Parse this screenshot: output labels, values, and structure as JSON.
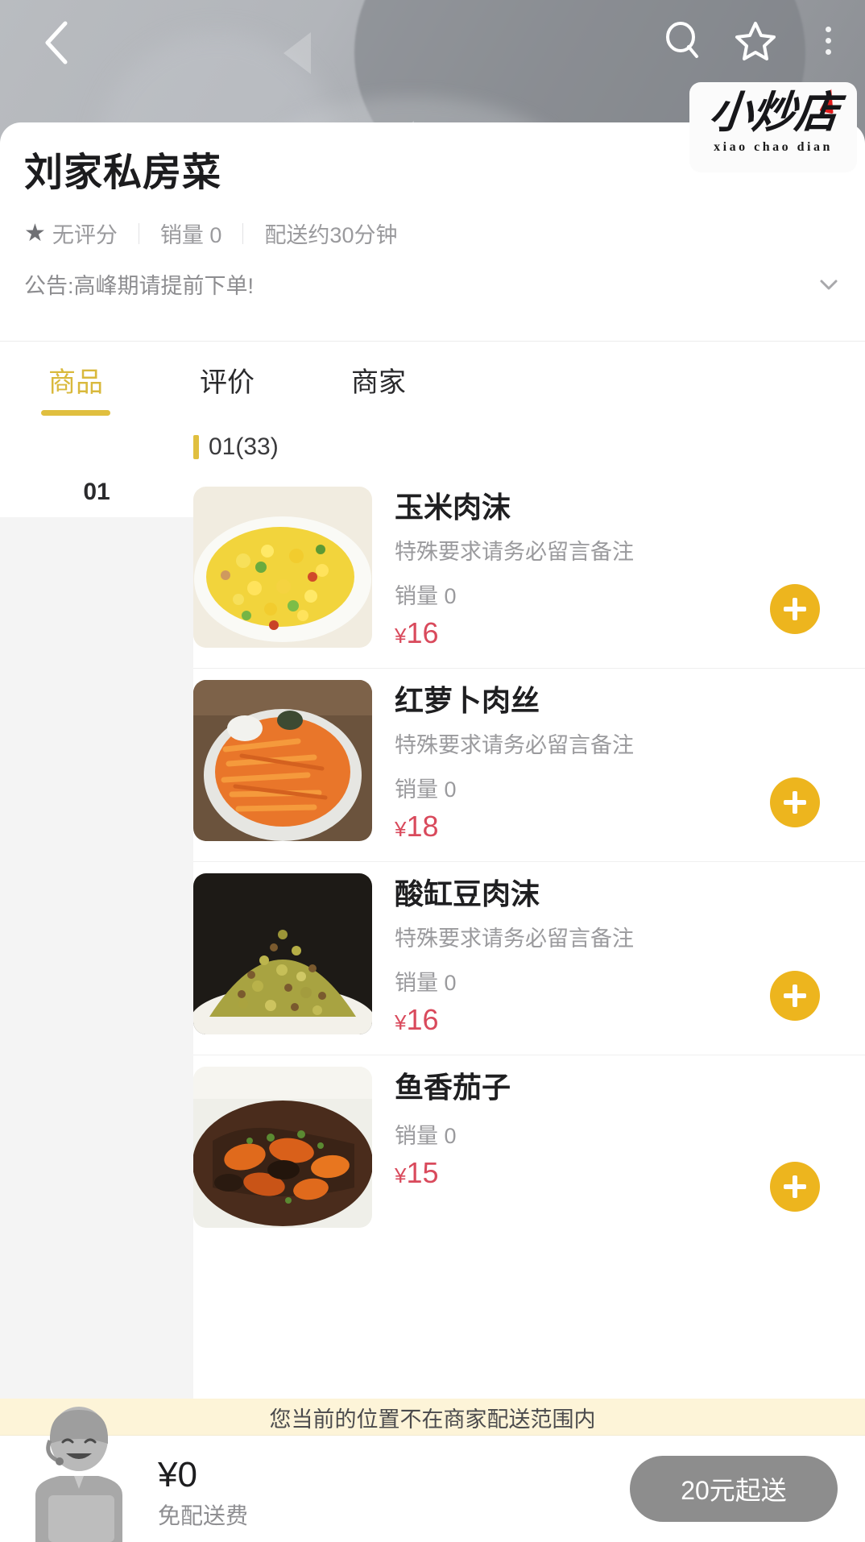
{
  "header": {
    "back_icon": "chevron-left-icon",
    "search_icon": "search-icon",
    "favorite_icon": "star-outline-icon",
    "more_icon": "more-vertical-icon"
  },
  "logo": {
    "chinese": "小炒店",
    "pinyin": "xiao chao dian"
  },
  "shop": {
    "name": "刘家私房菜",
    "rating": "无评分",
    "sales": "销量 0",
    "delivery": "配送约30分钟",
    "notice": "公告:高峰期请提前下单!",
    "notice_chevron": "chevron-down-icon"
  },
  "tabs": [
    {
      "label": "商品",
      "active": true
    },
    {
      "label": "评价",
      "active": false
    },
    {
      "label": "商家",
      "active": false
    }
  ],
  "categories": [
    {
      "label": "01"
    }
  ],
  "section": {
    "title": "01(33)"
  },
  "items": [
    {
      "name": "玉米肉沫",
      "desc": "特殊要求请务必留言备注",
      "sales": "销量 0",
      "price": "16",
      "currency": "¥",
      "add_label": "+"
    },
    {
      "name": "红萝卜肉丝",
      "desc": "特殊要求请务必留言备注",
      "sales": "销量 0",
      "price": "18",
      "currency": "¥",
      "add_label": "+"
    },
    {
      "name": "酸缸豆肉沫",
      "desc": "特殊要求请务必留言备注",
      "sales": "销量 0",
      "price": "16",
      "currency": "¥",
      "add_label": "+"
    },
    {
      "name": "鱼香茄子",
      "desc": "",
      "sales": "销量 0",
      "price": "15",
      "currency": "¥",
      "add_label": "+"
    }
  ],
  "bottom": {
    "warning": "您当前的位置不在商家配送范围内",
    "cart_amount": "¥0",
    "delivery_fee": "免配送费",
    "min_order_button": "20元起送"
  },
  "colors": {
    "accent_gold": "#e0bf3f",
    "price_red": "#d94a5c",
    "warn_bg": "#fdf4d8",
    "disabled_gray": "#8d8d8d"
  }
}
